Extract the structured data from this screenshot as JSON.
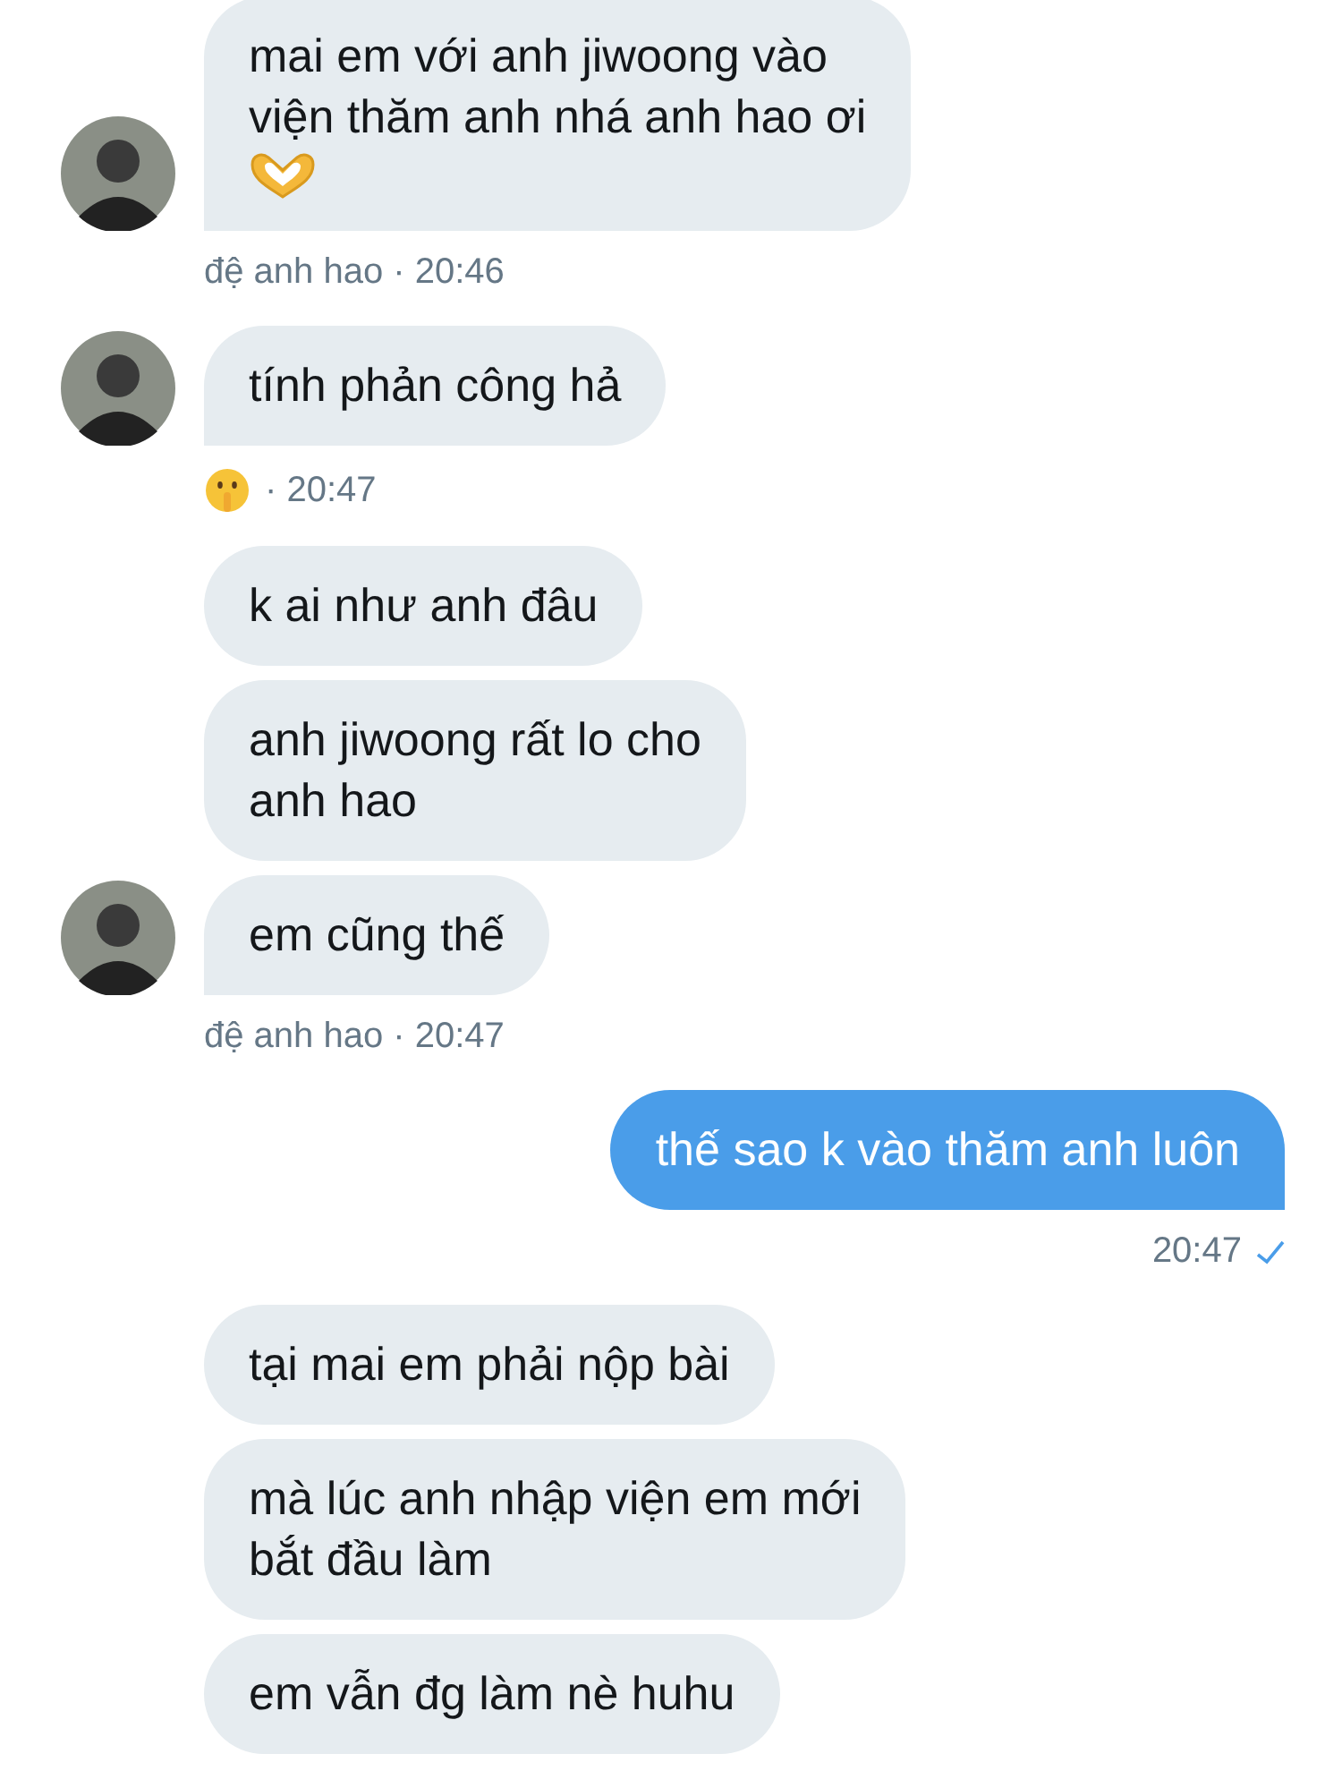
{
  "groups": [
    {
      "kind": "received",
      "avatar": true,
      "messages": [
        {
          "kind": "text_with_emoji",
          "text": "mai em với anh jiwoong vào\nviện thăm anh nhá anh hao ơi"
        }
      ],
      "footer": {
        "kind": "sender",
        "text": "đệ anh hao · 20:46"
      }
    },
    {
      "kind": "received",
      "avatar": true,
      "messages": [
        {
          "kind": "text",
          "text": "tính phản công hả"
        }
      ],
      "footer": {
        "kind": "reaction",
        "text": "· 20:47"
      }
    },
    {
      "kind": "received",
      "avatar": true,
      "messages": [
        {
          "kind": "text",
          "text": "k ai như anh đâu"
        },
        {
          "kind": "text",
          "text": "anh jiwoong rất lo cho\nanh hao"
        },
        {
          "kind": "text",
          "text": "em cũng thế"
        }
      ],
      "footer": {
        "kind": "sender",
        "text": "đệ anh hao · 20:47"
      }
    },
    {
      "kind": "sent",
      "messages": [
        {
          "kind": "text",
          "text": "thế sao k vào thăm anh luôn"
        }
      ],
      "footer": {
        "kind": "sender",
        "text": "20:47",
        "read": true
      }
    },
    {
      "kind": "received",
      "messages": [
        {
          "kind": "text",
          "text": "tại mai em phải nộp bài"
        },
        {
          "kind": "text",
          "text": "mà lúc anh nhập viện em mới\nbắt đầu làm"
        },
        {
          "kind": "text",
          "text": "em vẫn đg làm nè huhu"
        }
      ]
    }
  ]
}
